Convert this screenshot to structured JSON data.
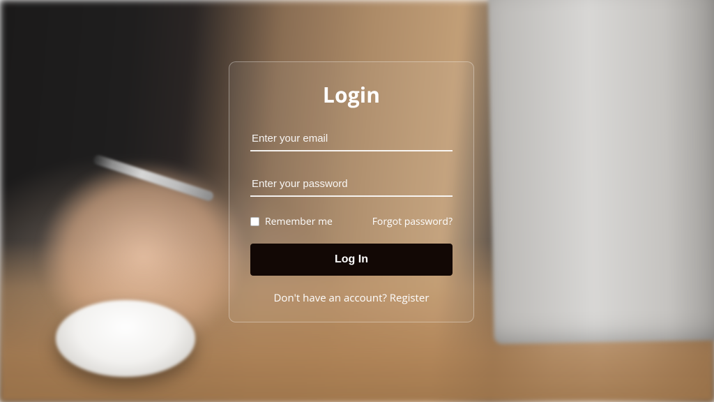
{
  "login": {
    "title": "Login",
    "email_placeholder": "Enter your email",
    "email_value": "",
    "password_placeholder": "Enter your password",
    "password_value": "",
    "remember_label": "Remember me",
    "forgot_label": "Forgot password?",
    "submit_label": "Log In",
    "register_prefix": "Don't have an account? ",
    "register_link": "Register"
  }
}
